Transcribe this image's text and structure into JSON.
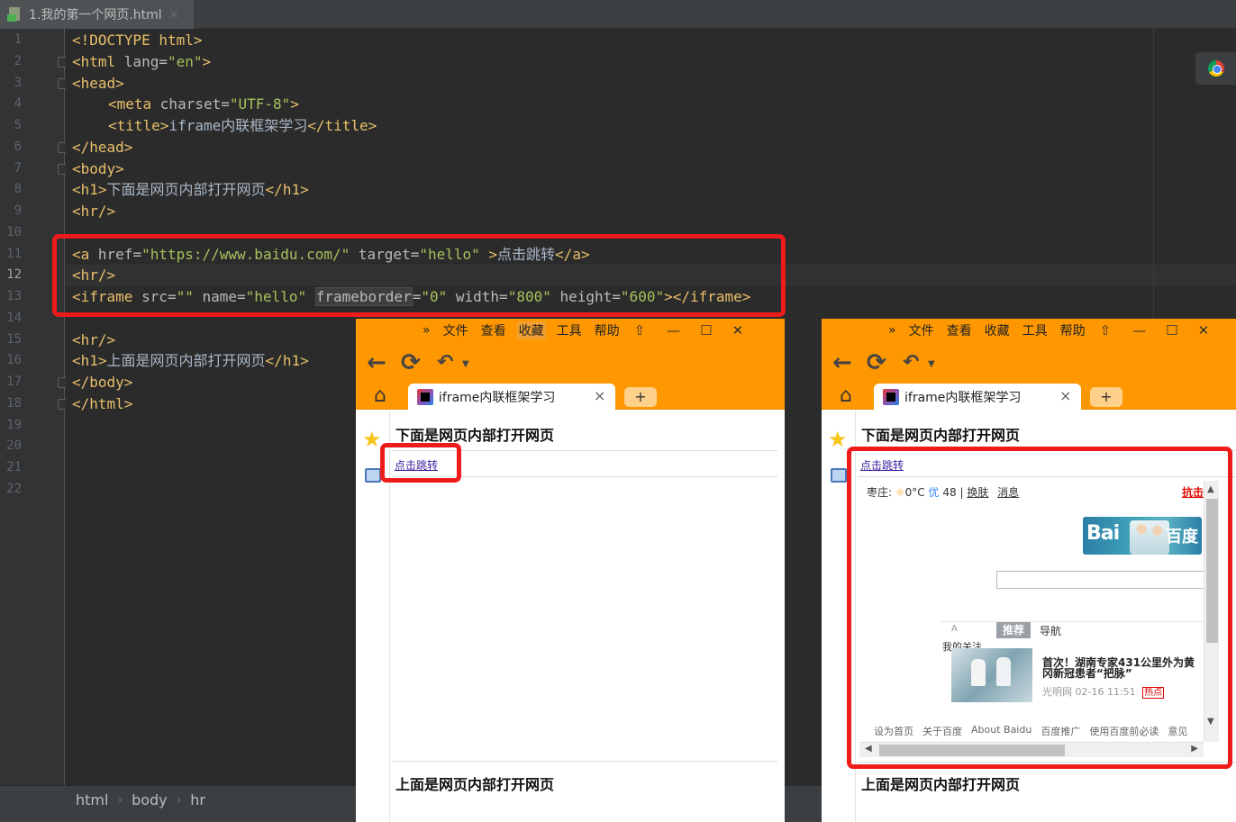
{
  "editor": {
    "tab_title": "1.我的第一个网页.html",
    "tab_close": "×",
    "line_numbers": [
      "1",
      "2",
      "3",
      "4",
      "5",
      "6",
      "7",
      "8",
      "9",
      "10",
      "11",
      "12",
      "13",
      "14",
      "15",
      "16",
      "17",
      "18",
      "19",
      "20",
      "21",
      "22"
    ],
    "current_line": "12",
    "code": {
      "l1": "<!DOCTYPE html>",
      "l2_open": "<html ",
      "l2_attr": "lang=",
      "l2_val": "\"en\"",
      "l2_close": ">",
      "l3": "<head>",
      "l4_open": "<meta ",
      "l4_attr": "charset=",
      "l4_val": "\"UTF-8\"",
      "l4_close": ">",
      "l5_open": "<title>",
      "l5_text": "iframe内联框架学习",
      "l5_close": "</title>",
      "l6": "</head>",
      "l7": "<body>",
      "l8_open": "<h1>",
      "l8_text": "下面是网页内部打开网页",
      "l8_close": "</h1>",
      "l9": "<hr/>",
      "l11_open": "<a ",
      "l11_attr1": "href=",
      "l11_val1": "\"https://www.baidu.com/\"",
      "l11_attr2": " target=",
      "l11_val2": "\"hello\"",
      "l11_mid": " >",
      "l11_text": "点击跳转",
      "l11_close": "</a>",
      "l12": "<hr/>",
      "l13_open": "<iframe ",
      "l13_attr1": "src=",
      "l13_val1": "\"\"",
      "l13_attr2": " name=",
      "l13_val2": "\"hello\"",
      "l13_attr3": "frameborder",
      "l13_eq3": "=",
      "l13_val3": "\"0\"",
      "l13_attr4": " width=",
      "l13_val4": "\"800\"",
      "l13_attr5": " height=",
      "l13_val5": "\"600\"",
      "l13_close": "></iframe>",
      "l15": "<hr/>",
      "l16_open": "<h1>",
      "l16_text": "上面是网页内部打开网页",
      "l16_close": "</h1>",
      "l17": "</body>",
      "l18": "</html>"
    },
    "breadcrumb": [
      "html",
      "body",
      "hr"
    ],
    "breadcrumb_sep": "›"
  },
  "browser": {
    "menu": [
      "»",
      "文件",
      "查看",
      "收藏",
      "工具",
      "帮助"
    ],
    "menu_active": "收藏",
    "window_controls": [
      "⇧",
      "—",
      "☐",
      "✕"
    ],
    "nav_icons": [
      "back-icon",
      "refresh-icon",
      "undo-icon"
    ],
    "tab_title": "iframe内联框架学习",
    "tab_close": "×",
    "new_tab": "+",
    "page_h1_top": "下面是网页内部打开网页",
    "page_link": "点击跳转",
    "page_h1_bottom": "上面是网页内部打开网页"
  },
  "baidu": {
    "city": "枣庄:",
    "sun": "☼",
    "temp": "0°C",
    "aqi_label": "优",
    "aqi_value": "48",
    "sep": "|",
    "change_city": "换肤",
    "messages": "消息",
    "red_link": "抗击",
    "logo_text": "Bai",
    "logo_cn": "百度",
    "feed_tab_a": "A",
    "feed_tab_recommend": "推荐",
    "feed_tab_nav": "导航",
    "my_focus": "我的关注",
    "news_title": "首次！湖南专家431公里外为黄冈新冠患者“把脉”",
    "news_source": "光明网",
    "news_time": "02-16 11:51",
    "news_hot": "热点",
    "footer": [
      "设为首页",
      "关于百度",
      "About Baidu",
      "百度推广",
      "使用百度前必读",
      "意见"
    ]
  },
  "colors": {
    "browser_orange": "#ff9800",
    "highlight_red": "#ee1b1b",
    "ide_bg": "#2b2b2b"
  }
}
